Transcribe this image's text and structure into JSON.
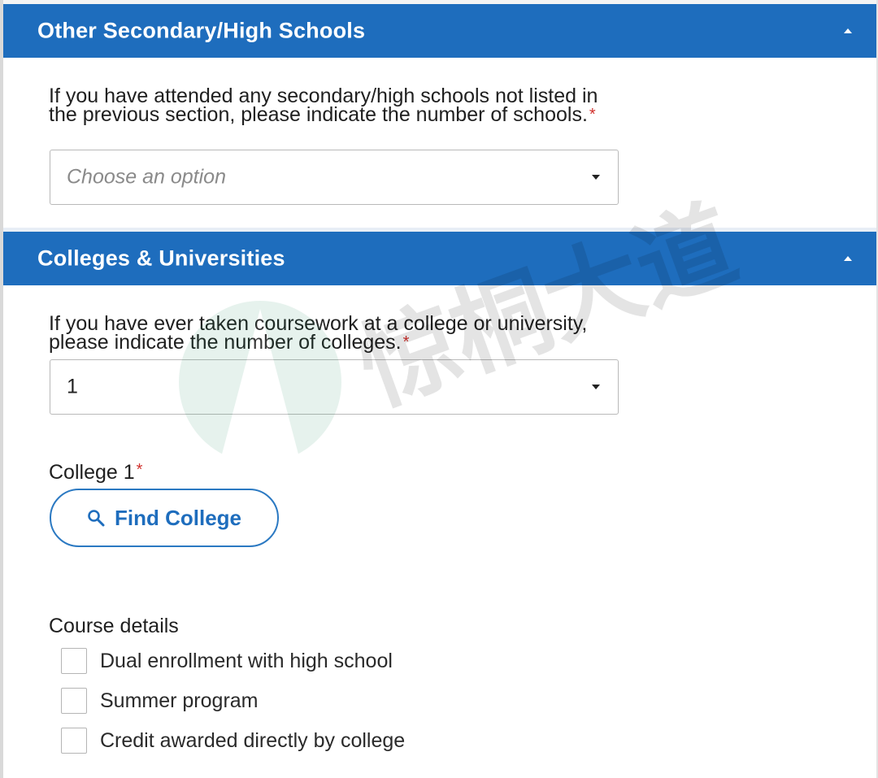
{
  "sections": {
    "other_schools": {
      "title": "Other Secondary/High Schools",
      "question": "If you have attended any secondary/high schools not listed in the previous section, please indicate the number of schools.",
      "required_mark": "*",
      "select": {
        "value": "Choose an option",
        "is_placeholder": true
      }
    },
    "colleges": {
      "title": "Colleges & Universities",
      "question": "If you have ever taken coursework at a college or university, please indicate the number of colleges.",
      "required_mark": "*",
      "select": {
        "value": "1",
        "is_placeholder": false
      },
      "college_label": "College 1",
      "college_required_mark": "*",
      "find_button": {
        "label": "Find College",
        "icon": "search-icon"
      },
      "course_details": {
        "label": "Course details",
        "options": [
          {
            "label": "Dual enrollment with high school",
            "checked": false
          },
          {
            "label": "Summer program",
            "checked": false
          },
          {
            "label": "Credit awarded directly by college",
            "checked": false
          }
        ]
      }
    }
  },
  "watermark": {
    "text": "惊桐大道"
  },
  "colors": {
    "header_bg": "#1e6dbd",
    "required": "#d0312d",
    "button_border": "#2b79c2"
  }
}
